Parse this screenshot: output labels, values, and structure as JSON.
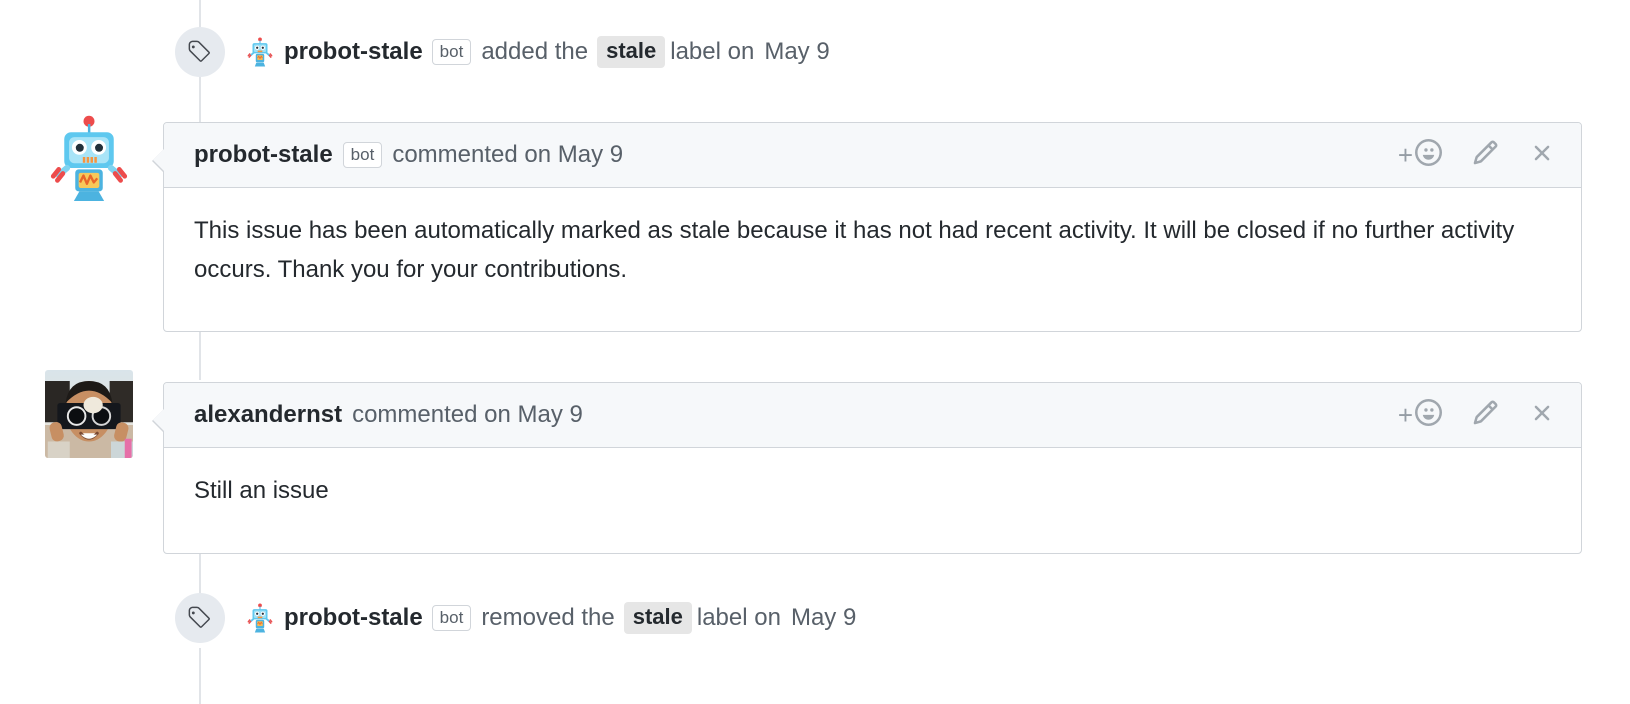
{
  "timeline": [
    {
      "id": "label-added",
      "icon": "tag-icon",
      "actor": "probot-stale",
      "actor_badge": "bot",
      "verb": "added the",
      "label": "stale",
      "suffix": "label on",
      "date": "May 9"
    },
    {
      "id": "label-removed",
      "icon": "tag-icon",
      "actor": "probot-stale",
      "actor_badge": "bot",
      "verb": "removed the",
      "label": "stale",
      "suffix": "label on",
      "date": "May 9"
    }
  ],
  "comments": [
    {
      "id": "comment-probot-stale",
      "author": "probot-stale",
      "author_badge": "bot",
      "meta": "commented on May 9",
      "avatar": "probot-robot-avatar",
      "body": "This issue has been automatically marked as stale because it has not had recent activity. It will be closed if no further activity occurs. Thank you for your contributions.",
      "actions": {
        "react_plus": "+",
        "react_icon": "smiley-icon",
        "edit_icon": "pencil-icon",
        "close_icon": "x-icon"
      }
    },
    {
      "id": "comment-alexandernst",
      "author": "alexandernst",
      "author_badge": "",
      "meta": "commented on May 9",
      "avatar": "user-photo-avatar",
      "body": "Still an issue",
      "actions": {
        "react_plus": "+",
        "react_icon": "smiley-icon",
        "edit_icon": "pencil-icon",
        "close_icon": "x-icon"
      }
    }
  ],
  "colors": {
    "border": "#d1d5da",
    "header_bg": "#f6f8fa",
    "rail": "#e1e4e8",
    "badge_bg": "#e6eaef",
    "muted_text": "#586069",
    "text": "#24292e",
    "label_chip_bg": "#e6e6e6",
    "icon": "#a0a7ae"
  }
}
